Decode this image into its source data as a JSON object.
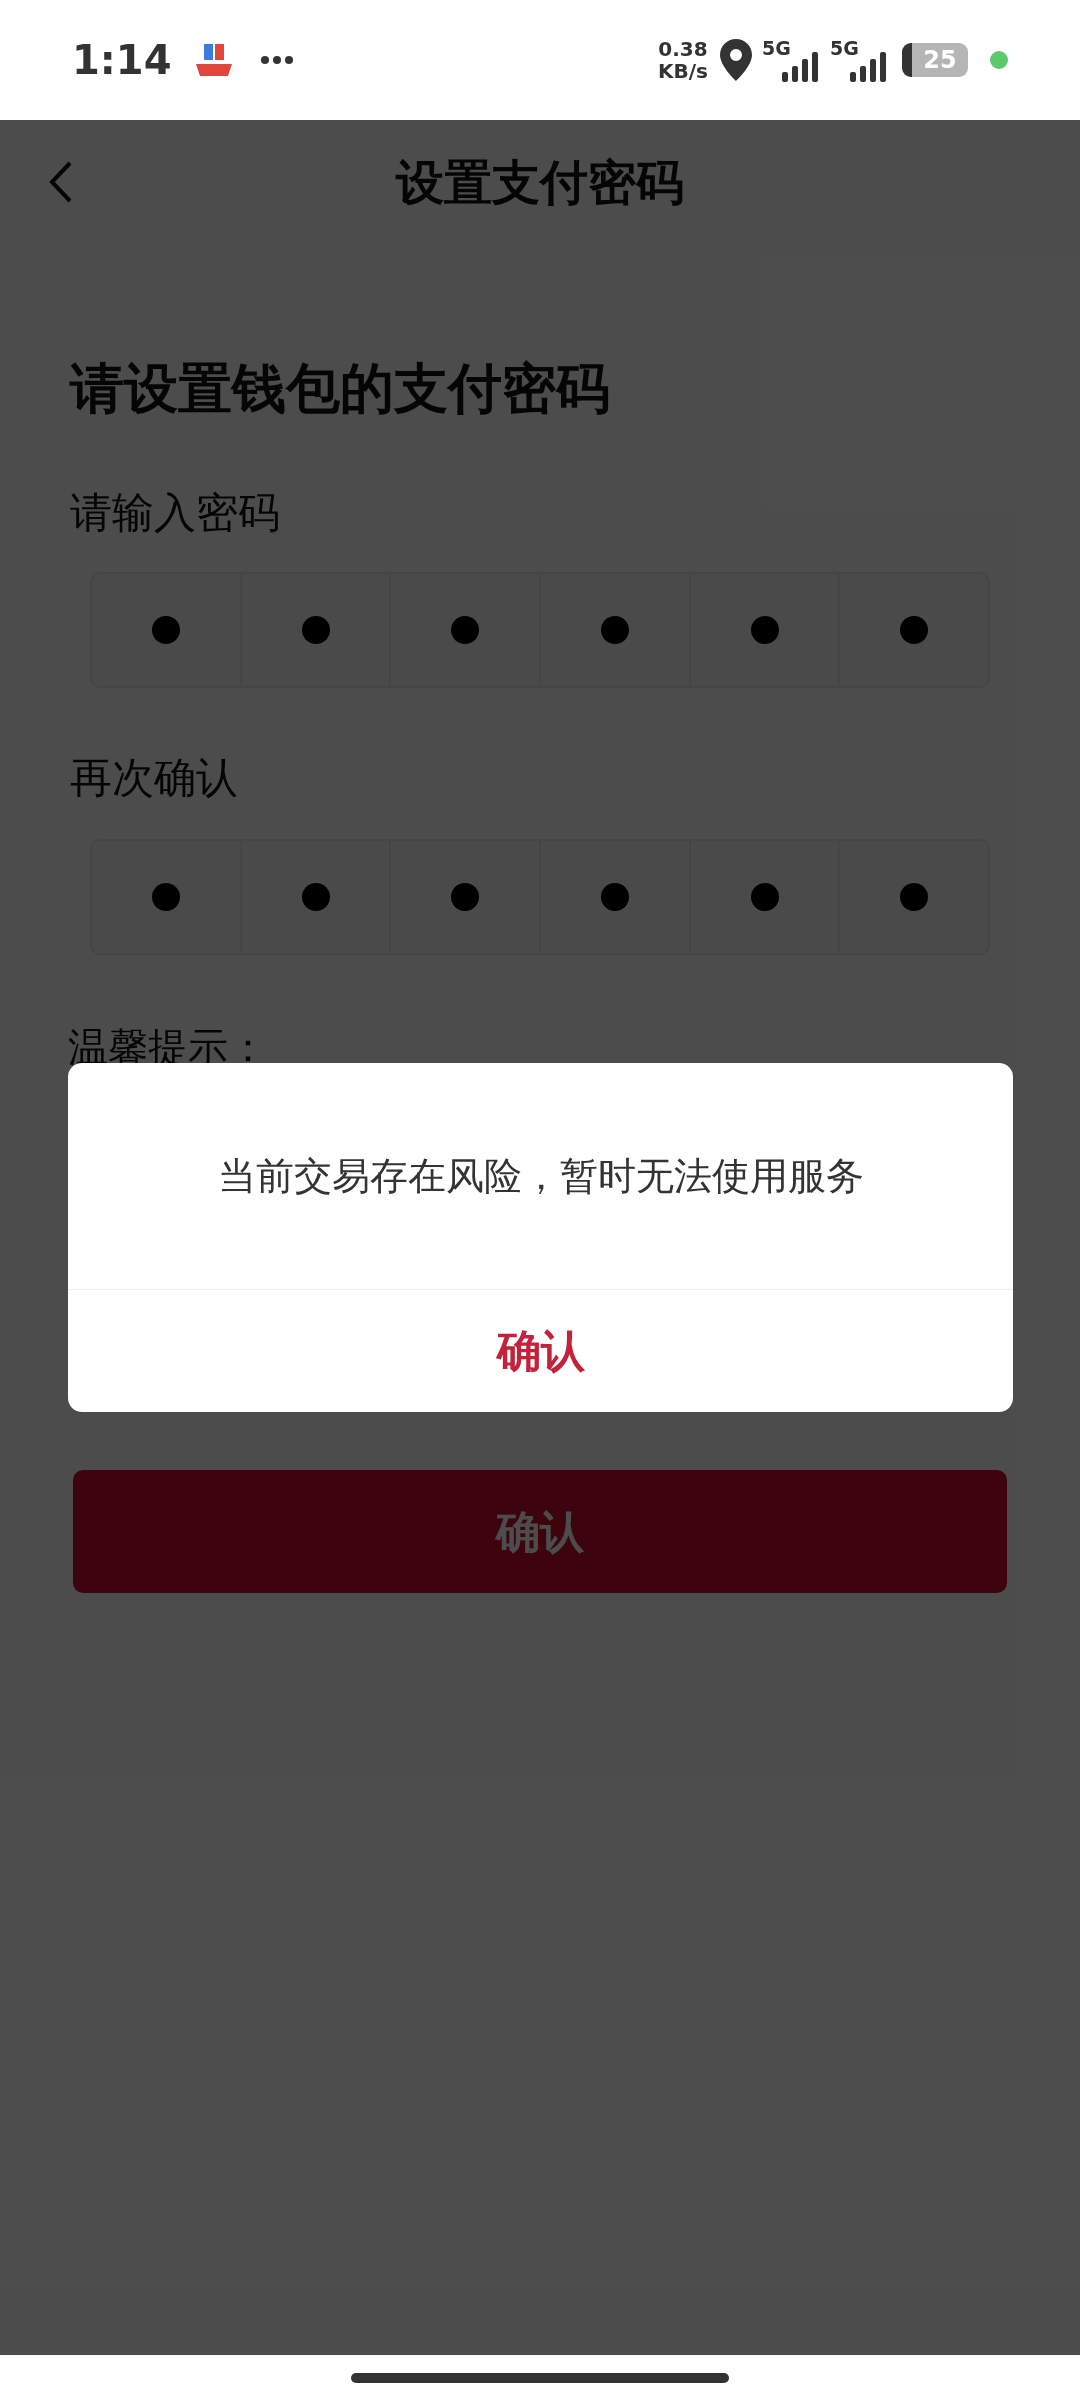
{
  "status_bar": {
    "time": "1:14",
    "speed_value": "0.38",
    "speed_unit": "KB/s",
    "network_1": "5G",
    "network_2": "5G",
    "battery": "25"
  },
  "nav": {
    "title": "设置支付密码"
  },
  "heading": "请设置钱包的支付密码",
  "password": {
    "label": "请输入密码",
    "digits": [
      {
        "filled": true
      },
      {
        "filled": true
      },
      {
        "filled": true
      },
      {
        "filled": true
      },
      {
        "filled": true
      },
      {
        "filled": true
      }
    ]
  },
  "confirm_password": {
    "label": "再次确认",
    "digits": [
      {
        "filled": true
      },
      {
        "filled": true
      },
      {
        "filled": true
      },
      {
        "filled": true
      },
      {
        "filled": true
      },
      {
        "filled": true
      }
    ]
  },
  "hint_title": "温馨提示：",
  "submit_button": {
    "label": "确认",
    "disabled": false
  },
  "dialog": {
    "message": "当前交易存在风险，暂时无法使用服务",
    "button": "确认"
  }
}
